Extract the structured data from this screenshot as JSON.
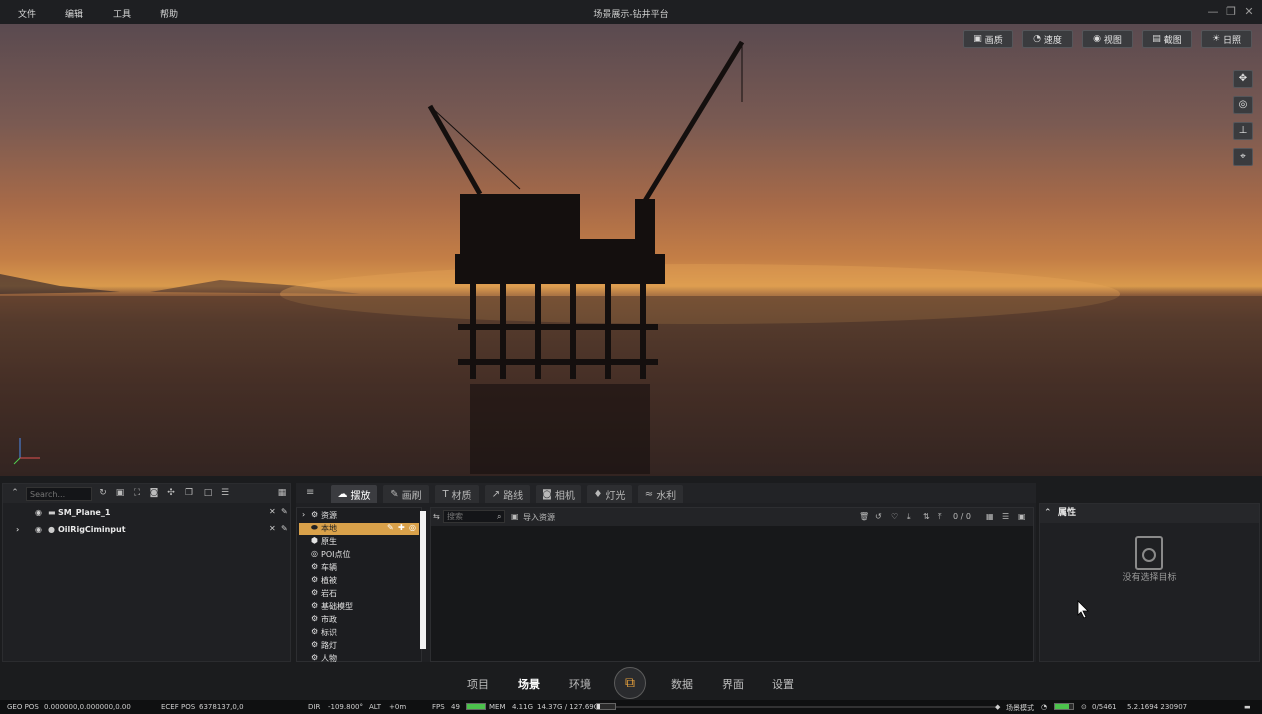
{
  "menu": [
    "文件",
    "编辑",
    "工具",
    "帮助"
  ],
  "window_title": "场景展示-钻井平台",
  "viewport_tools": [
    "画质",
    "速度",
    "视图",
    "截图",
    "日照"
  ],
  "outliner": {
    "search_placeholder": "Search...",
    "rows": [
      {
        "name": "SM_Plane_1"
      },
      {
        "name": "OilRigCiminput"
      }
    ]
  },
  "asset_tabs": [
    "摆放",
    "画刷",
    "材质",
    "路线",
    "相机",
    "灯光",
    "水利"
  ],
  "asset_tree": [
    "资源",
    "本地",
    "原生",
    "POI点位",
    "车辆",
    "植被",
    "岩石",
    "基础模型",
    "市政",
    "标识",
    "路灯",
    "人物"
  ],
  "asset_search_placeholder": "搜索",
  "import_label": "导入资源",
  "asset_count": "0 / 0",
  "properties": {
    "title": "属性",
    "empty_text": "没有选择目标"
  },
  "bottom_nav": [
    "项目",
    "场景",
    "环境",
    "数据",
    "界面",
    "设置"
  ],
  "status": {
    "geo_label": "GEO POS",
    "geo_value": "0.000000,0.000000,0.00",
    "ecef_label": "ECEF POS",
    "ecef_value": "6378137,0,0",
    "dir_label": "DIR",
    "dir_value": "-109.800°",
    "alt_label": "ALT",
    "alt_value": "+0m",
    "fps_label": "FPS",
    "fps_value": "49",
    "mem_label": "MEM",
    "mem_value": "4.11G",
    "disk_value": "14.37G / 127.69G",
    "mode_label": "场景模式",
    "count_value": "0/5461",
    "version": "5.2.1694 230907"
  },
  "colors": {
    "accent": "#d9a14a",
    "fps_bar": "#4cc24c"
  }
}
